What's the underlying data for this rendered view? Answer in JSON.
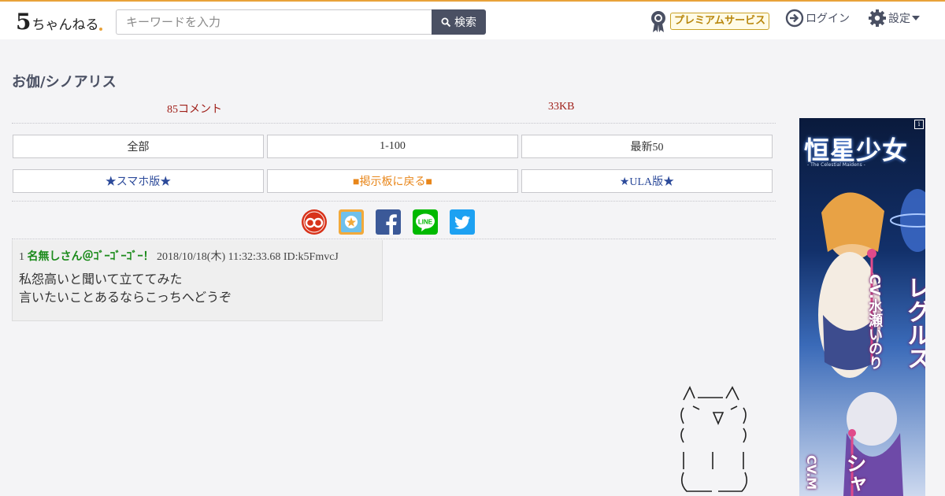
{
  "header": {
    "logo_text": "5ちゃんねる",
    "search_placeholder": "キーワードを入力",
    "search_button_label": "検索",
    "premium_label": "プレミアムサービス",
    "login_label": "ログイン",
    "settings_label": "設定"
  },
  "thread": {
    "title": "お伽/シノアリス",
    "comment_count": "85コメント",
    "size": "33KB"
  },
  "nav_buttons": {
    "all": "全部",
    "range": "1-100",
    "latest": "最新50",
    "smartphone": "★スマホ版★",
    "back_to_board": "■掲示板に戻る■",
    "ula": "★ULA版★"
  },
  "share_icons": [
    "sussu-icon",
    "bookmark-icon",
    "facebook-icon",
    "line-icon",
    "twitter-icon"
  ],
  "posts": [
    {
      "number": "1",
      "name": "名無しさん＠ｺﾞｰｺﾞｰｺﾞｰ！",
      "date": "2018/10/18(木) 11:32:33.68",
      "id": "ID:k5FmvcJ",
      "line1": "私怨高いと聞いて立ててみた",
      "line2": "言いたいことあるならこっちへどうぞ"
    }
  ],
  "ad": {
    "title": "恒星少女",
    "subtitle": "- The Celestial Maidens -",
    "char1_name": "レグルス",
    "char1_cv": "CV.水瀬いのり",
    "char2_name": "シャ",
    "char2_cv": "CV.M"
  },
  "colors": {
    "accent": "#e8a23a",
    "button_dark": "#4a5063",
    "meta_red": "#a0201a",
    "poster_green": "#1a8a1a",
    "link_blue": "#2c4a9a",
    "link_orange": "#e8861a"
  }
}
